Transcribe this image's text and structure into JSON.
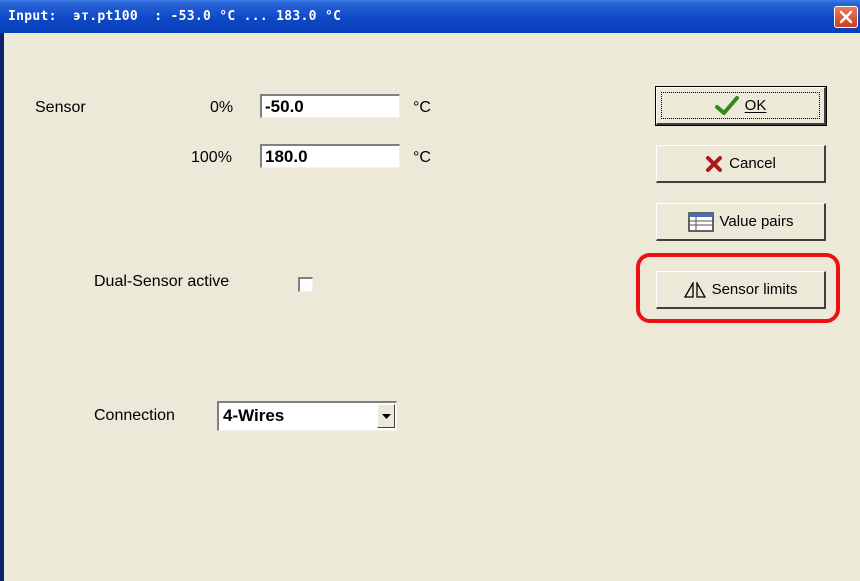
{
  "window": {
    "title": "Input:  ϶т.pt100  : -53.0 °C ... 183.0 °C"
  },
  "sensor": {
    "label": "Sensor",
    "min_percent": "0%",
    "min_value": "-50.0",
    "max_percent": "100%",
    "max_value": "180.0",
    "unit": "°C"
  },
  "dual_sensor": {
    "label": "Dual-Sensor active",
    "checked": false
  },
  "connection": {
    "label": "Connection",
    "selected": "4-Wires"
  },
  "buttons": {
    "ok": "OK",
    "cancel": "Cancel",
    "value_pairs": "Value pairs",
    "sensor_limits": "Sensor limits"
  },
  "colors": {
    "accent_highlight": "#ee1111",
    "dialog_bg": "#ece9d8",
    "titlebar": "#0e48c8"
  },
  "icons": {
    "ok": "checkmark-icon",
    "cancel": "x-icon",
    "value_pairs": "table-icon",
    "sensor_limits": "triangles-icon",
    "close": "close-icon"
  }
}
